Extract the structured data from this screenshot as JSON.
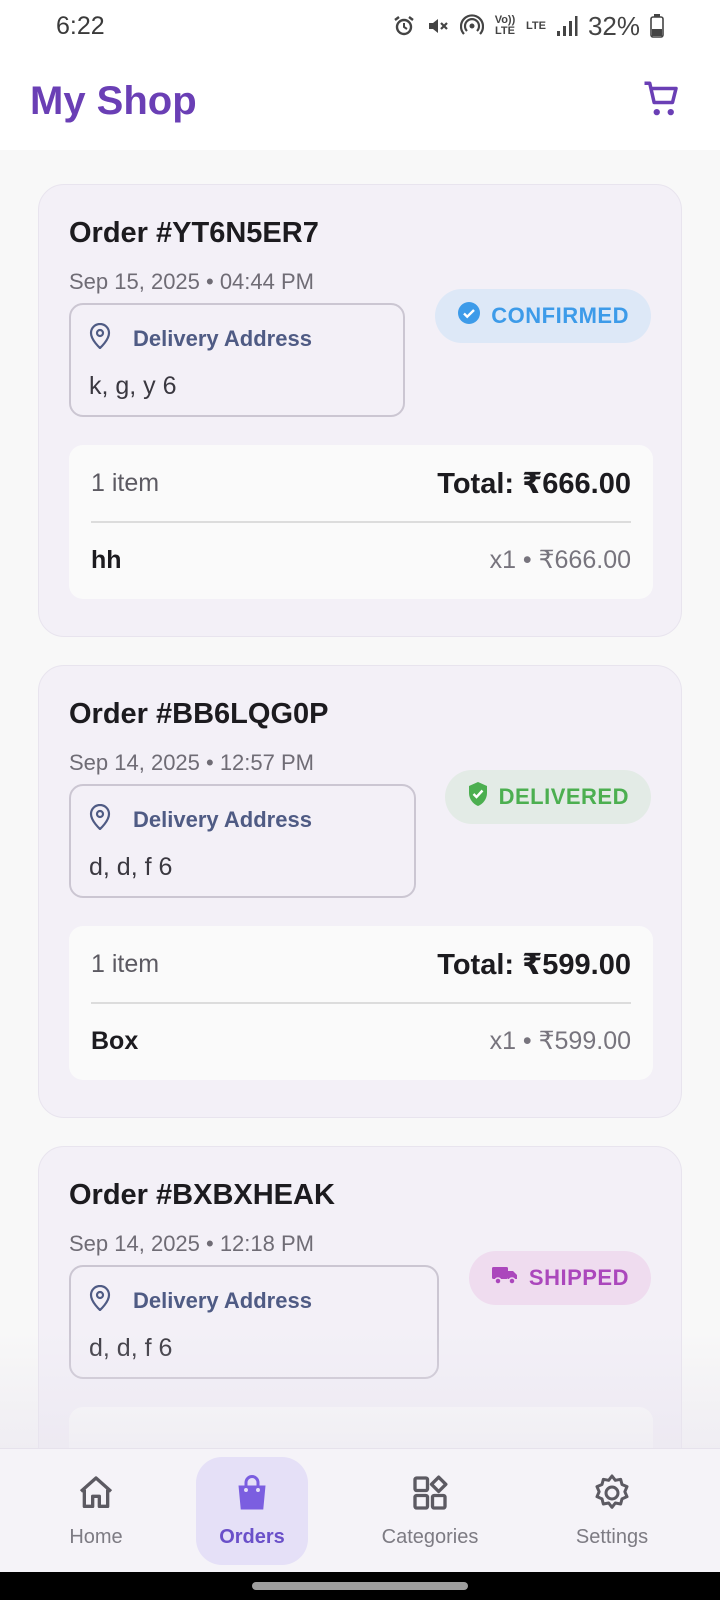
{
  "status_bar": {
    "time": "6:22",
    "lte_label_1": "Vo)) LTE",
    "lte_label_2": "LTE",
    "battery": "32%"
  },
  "app_bar": {
    "title": "My Shop",
    "cart_icon": "shopping-cart-icon",
    "accent_color": "#6a3fb5"
  },
  "orders": [
    {
      "title": "Order #YT6N5ER7",
      "date": "Sep 15, 2025 • 04:44 PM",
      "address_label": "Delivery Address",
      "address": "k, g, y 6",
      "status": "CONFIRMED",
      "status_icon": "check-circle-icon",
      "status_color": "#3d9be9",
      "item_count": "1 item",
      "total": "Total: ₹666.00",
      "items": [
        {
          "name": "hh",
          "qty_price": "x1 • ₹666.00"
        }
      ]
    },
    {
      "title": "Order #BB6LQG0P",
      "date": "Sep 14, 2025 • 12:57 PM",
      "address_label": "Delivery Address",
      "address": "d, d, f 6",
      "status": "DELIVERED",
      "status_icon": "verified-shield-icon",
      "status_color": "#4caf50",
      "item_count": "1 item",
      "total": "Total: ₹599.00",
      "items": [
        {
          "name": "Box",
          "qty_price": "x1 • ₹599.00"
        }
      ]
    },
    {
      "title": "Order #BXBXHEAK",
      "date": "Sep 14, 2025 • 12:18 PM",
      "address_label": "Delivery Address",
      "address": "d, d, f 6",
      "status": "SHIPPED",
      "status_icon": "truck-icon",
      "status_color": "#ab47bc"
    }
  ],
  "bottom_nav": {
    "items": [
      {
        "label": "Home",
        "icon": "home-icon",
        "active": false
      },
      {
        "label": "Orders",
        "icon": "shopping-bag-icon",
        "active": true
      },
      {
        "label": "Categories",
        "icon": "categories-icon",
        "active": false
      },
      {
        "label": "Settings",
        "icon": "gear-icon",
        "active": false
      }
    ]
  }
}
